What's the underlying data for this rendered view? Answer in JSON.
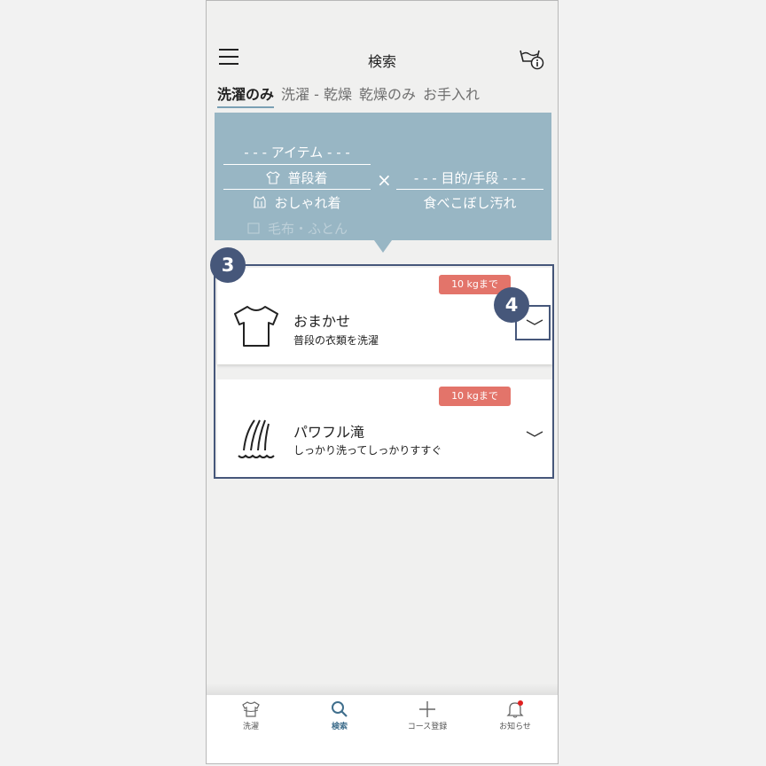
{
  "header": {
    "title": "検索"
  },
  "tabs": [
    {
      "label": "洗濯のみ",
      "active": true
    },
    {
      "label": "洗濯 - 乾燥",
      "active": false
    },
    {
      "label": "乾燥のみ",
      "active": false
    },
    {
      "label": "お手入れ",
      "active": false
    }
  ],
  "filter": {
    "item_header": "- - - アイテム - - -",
    "items": [
      "普段着",
      "おしゃれ着",
      "毛布・ふとん"
    ],
    "times": "×",
    "purpose_header": "- - - 目的/手段 - - -",
    "purposes": [
      "食べこぼし汚れ"
    ]
  },
  "results": [
    {
      "badge": "10 kgまで",
      "title": "おまかせ",
      "desc": "普段の衣類を洗濯",
      "icon": "tshirt-icon"
    },
    {
      "badge": "10 kgまで",
      "title": "パワフル滝",
      "desc": "しっかり洗ってしっかりすすぐ",
      "icon": "waterfall-icon"
    }
  ],
  "markers": [
    "3",
    "4"
  ],
  "nav": [
    {
      "label": "洗濯",
      "icon": "tshirt-icon",
      "active": false
    },
    {
      "label": "検索",
      "icon": "search-icon",
      "active": true
    },
    {
      "label": "コース登録",
      "icon": "plus-icon",
      "active": false
    },
    {
      "label": "お知らせ",
      "icon": "bell-icon",
      "active": false
    }
  ],
  "colors": {
    "accent": "#46577a",
    "filter_bg": "#98b6c4",
    "badge": "#e3746a",
    "notification_dot": "#e02020"
  }
}
